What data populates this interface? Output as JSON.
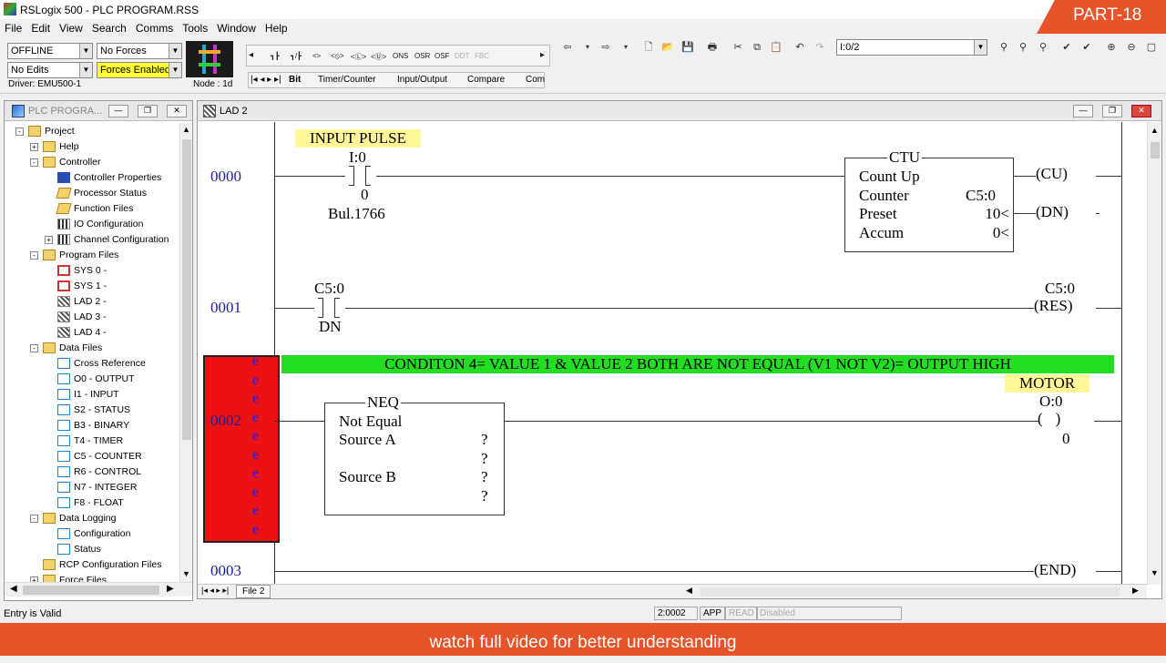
{
  "app": {
    "title": "RSLogix 500 - PLC PROGRAM.RSS",
    "badge": "PART-18"
  },
  "menu": [
    "File",
    "Edit",
    "View",
    "Search",
    "Comms",
    "Tools",
    "Window",
    "Help"
  ],
  "toolbar": {
    "mode": "OFFLINE",
    "forces": "No Forces",
    "edits": "No Edits",
    "forces_enabled": "Forces Enabled",
    "driver": "Driver: EMU500-1",
    "node": "Node : 1d",
    "instructions": [
      "┓┣",
      "┓/┣",
      "<>",
      "<⦸>",
      "<Ⓛ>",
      "<Ⓤ>",
      "ONS",
      "OSR",
      "OSF",
      "DDT",
      "FBC"
    ],
    "tabs": [
      "Bit",
      "Timer/Counter",
      "Input/Output",
      "Compare",
      "Com"
    ],
    "address": "I:0/2"
  },
  "project_panel": {
    "title": "PLC PROGRA...",
    "items": [
      {
        "label": "Project",
        "level": 0,
        "icon": "folder",
        "exp": "-"
      },
      {
        "label": "Help",
        "level": 1,
        "icon": "folder",
        "exp": "+"
      },
      {
        "label": "Controller",
        "level": 1,
        "icon": "folder",
        "exp": "-"
      },
      {
        "label": "Controller Properties",
        "level": 2,
        "icon": "info"
      },
      {
        "label": "Processor Status",
        "level": 2,
        "icon": "proc"
      },
      {
        "label": "Function Files",
        "level": 2,
        "icon": "proc"
      },
      {
        "label": "IO Configuration",
        "level": 2,
        "icon": "io"
      },
      {
        "label": "Channel Configuration",
        "level": 2,
        "icon": "io",
        "exp": "+"
      },
      {
        "label": "Program Files",
        "level": 1,
        "icon": "folder",
        "exp": "-"
      },
      {
        "label": "SYS 0 -",
        "level": 2,
        "icon": "red"
      },
      {
        "label": "SYS 1 -",
        "level": 2,
        "icon": "red"
      },
      {
        "label": "LAD 2 -",
        "level": 2,
        "icon": "lad"
      },
      {
        "label": "LAD 3 -",
        "level": 2,
        "icon": "lad"
      },
      {
        "label": "LAD 4 -",
        "level": 2,
        "icon": "lad"
      },
      {
        "label": "Data Files",
        "level": 1,
        "icon": "folder",
        "exp": "-"
      },
      {
        "label": "Cross Reference",
        "level": 2,
        "icon": "file"
      },
      {
        "label": "O0 - OUTPUT",
        "level": 2,
        "icon": "file"
      },
      {
        "label": "I1 - INPUT",
        "level": 2,
        "icon": "file"
      },
      {
        "label": "S2 - STATUS",
        "level": 2,
        "icon": "file"
      },
      {
        "label": "B3 - BINARY",
        "level": 2,
        "icon": "file"
      },
      {
        "label": "T4 - TIMER",
        "level": 2,
        "icon": "file"
      },
      {
        "label": "C5 - COUNTER",
        "level": 2,
        "icon": "file"
      },
      {
        "label": "R6 - CONTROL",
        "level": 2,
        "icon": "file"
      },
      {
        "label": "N7 - INTEGER",
        "level": 2,
        "icon": "file"
      },
      {
        "label": "F8 - FLOAT",
        "level": 2,
        "icon": "file"
      },
      {
        "label": "Data Logging",
        "level": 1,
        "icon": "folder",
        "exp": "-"
      },
      {
        "label": "Configuration",
        "level": 2,
        "icon": "file"
      },
      {
        "label": "Status",
        "level": 2,
        "icon": "file"
      },
      {
        "label": "RCP Configuration Files",
        "level": 1,
        "icon": "folder"
      },
      {
        "label": "Force Files",
        "level": 1,
        "icon": "folder",
        "exp": "+"
      }
    ]
  },
  "ladder": {
    "window_title": "LAD 2",
    "file_tab": "File 2",
    "rung0": {
      "num": "0000",
      "label": "INPUT PULSE",
      "contact_addr": "I:0",
      "contact_bit": "0",
      "contact_desc": "Bul.1766",
      "ctu": {
        "title": "CTU",
        "name": "Count Up",
        "counter_label": "Counter",
        "counter": "C5:0",
        "preset_label": "Preset",
        "preset": "10<",
        "accum_label": "Accum",
        "accum": "0<"
      },
      "cu": "CU",
      "dn": "DN"
    },
    "rung1": {
      "num": "0001",
      "contact_addr": "C5:0",
      "contact_bit": "DN",
      "coil_addr": "C5:0",
      "coil": "RES"
    },
    "rung2": {
      "num": "0002",
      "comment": "CONDITON 4= VALUE 1 & VALUE 2 BOTH ARE NOT EQUAL (V1 NOT V2)= OUTPUT HIGH",
      "neq": {
        "title": "NEQ",
        "name": "Not Equal",
        "srcA": "Source A",
        "srcB": "Source B",
        "q": "?"
      },
      "output_label": "MOTOR",
      "coil_addr": "O:0",
      "coil_bit": "0",
      "error_mark": "e"
    },
    "rung3": {
      "num": "0003",
      "end": "END"
    }
  },
  "status": {
    "left": "Entry is Valid",
    "addr": "2:0002",
    "app": "APP",
    "read": "READ",
    "disabled": "Disabled"
  },
  "banner": "watch full video for better understanding"
}
